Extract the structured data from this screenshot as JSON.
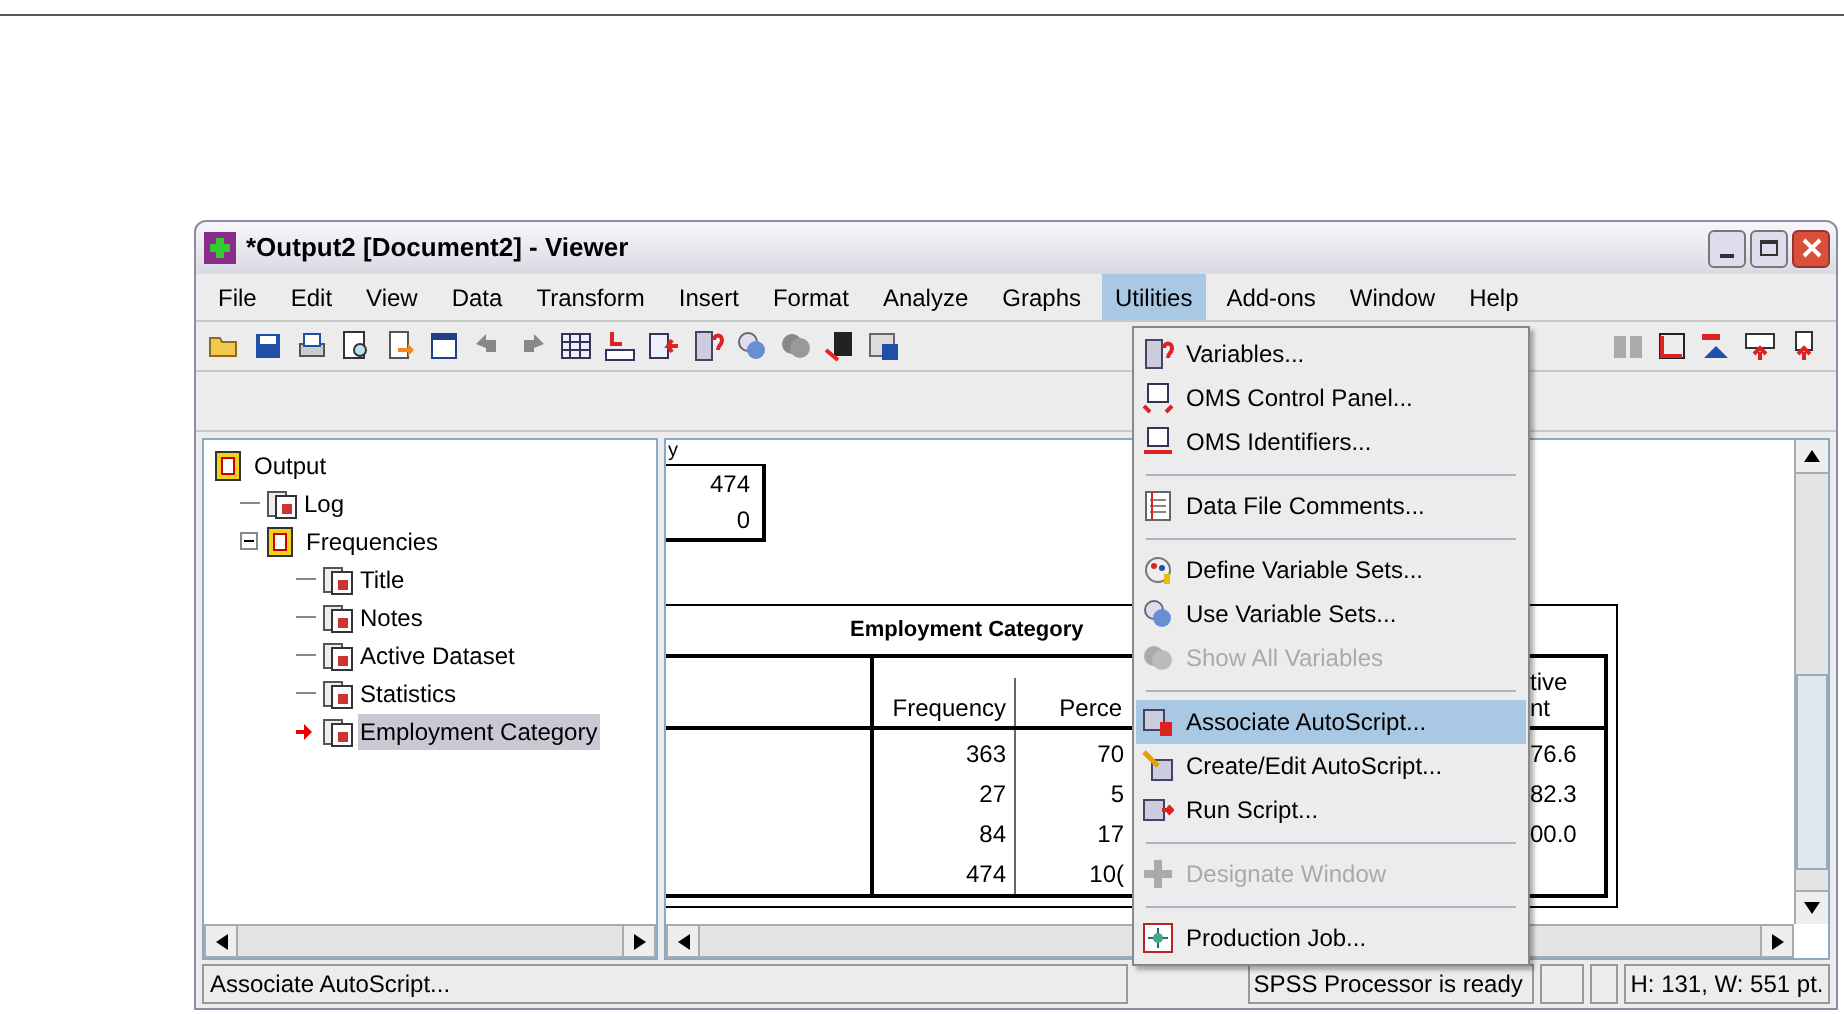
{
  "window": {
    "title": "*Output2 [Document2] - Viewer"
  },
  "menu_bar": [
    {
      "label": "File",
      "selected": false
    },
    {
      "label": "Edit",
      "selected": false
    },
    {
      "label": "View",
      "selected": false
    },
    {
      "label": "Data",
      "selected": false
    },
    {
      "label": "Transform",
      "selected": false
    },
    {
      "label": "Insert",
      "selected": false
    },
    {
      "label": "Format",
      "selected": false
    },
    {
      "label": "Analyze",
      "selected": false
    },
    {
      "label": "Graphs",
      "selected": false
    },
    {
      "label": "Utilities",
      "selected": true
    },
    {
      "label": "Add-ons",
      "selected": false
    },
    {
      "label": "Window",
      "selected": false
    },
    {
      "label": "Help",
      "selected": false
    }
  ],
  "outline": [
    {
      "label": "Output",
      "selected": false,
      "children": [
        {
          "label": "Log",
          "selected": false
        },
        {
          "label": "Frequencies",
          "selected": false,
          "expanded": true,
          "children": [
            {
              "label": "Title",
              "selected": false
            },
            {
              "label": "Notes",
              "selected": false
            },
            {
              "label": "Active Dataset",
              "selected": false
            },
            {
              "label": "Statistics",
              "selected": false
            },
            {
              "label": "Employment Category",
              "selected": true
            }
          ]
        }
      ]
    }
  ],
  "statistics_table": {
    "header": "y",
    "rows": [
      "474",
      "0"
    ]
  },
  "frequency_table": {
    "title": "Employment Category",
    "columns": [
      "Frequency",
      "Perce"
    ],
    "last_column": [
      "tive",
      "nt"
    ],
    "rows": [
      {
        "frequency": "363",
        "percent": "70",
        "cumulative": "76.6"
      },
      {
        "frequency": "27",
        "percent": "5",
        "cumulative": "82.3"
      },
      {
        "frequency": "84",
        "percent": "17",
        "cumulative": "00.0"
      },
      {
        "frequency": "474",
        "percent": "10(",
        "cumulative": ""
      }
    ]
  },
  "utilities_menu": [
    {
      "kind": "item",
      "label": "Variables...",
      "disabled": false,
      "selected": false
    },
    {
      "kind": "item",
      "label": "OMS Control Panel...",
      "disabled": false,
      "selected": false
    },
    {
      "kind": "item",
      "label": "OMS Identifiers...",
      "disabled": false,
      "selected": false
    },
    {
      "kind": "separator"
    },
    {
      "kind": "item",
      "label": "Data File Comments...",
      "disabled": false,
      "selected": false
    },
    {
      "kind": "separator"
    },
    {
      "kind": "item",
      "label": "Define Variable Sets...",
      "disabled": false,
      "selected": false
    },
    {
      "kind": "item",
      "label": "Use Variable Sets...",
      "disabled": false,
      "selected": false
    },
    {
      "kind": "item",
      "label": "Show All Variables",
      "disabled": true,
      "selected": false
    },
    {
      "kind": "separator"
    },
    {
      "kind": "item",
      "label": "Associate AutoScript...",
      "disabled": false,
      "selected": true
    },
    {
      "kind": "item",
      "label": "Create/Edit AutoScript...",
      "disabled": false,
      "selected": false
    },
    {
      "kind": "item",
      "label": "Run Script...",
      "disabled": false,
      "selected": false
    },
    {
      "kind": "separator"
    },
    {
      "kind": "item",
      "label": "Designate Window",
      "disabled": true,
      "selected": false
    },
    {
      "kind": "separator"
    },
    {
      "kind": "item",
      "label": "Production Job...",
      "disabled": false,
      "selected": false
    }
  ],
  "status_bar": {
    "message": "Associate AutoScript...",
    "processor": "SPSS  Processor is ready",
    "size": "H: 131, W: 551 pt."
  }
}
